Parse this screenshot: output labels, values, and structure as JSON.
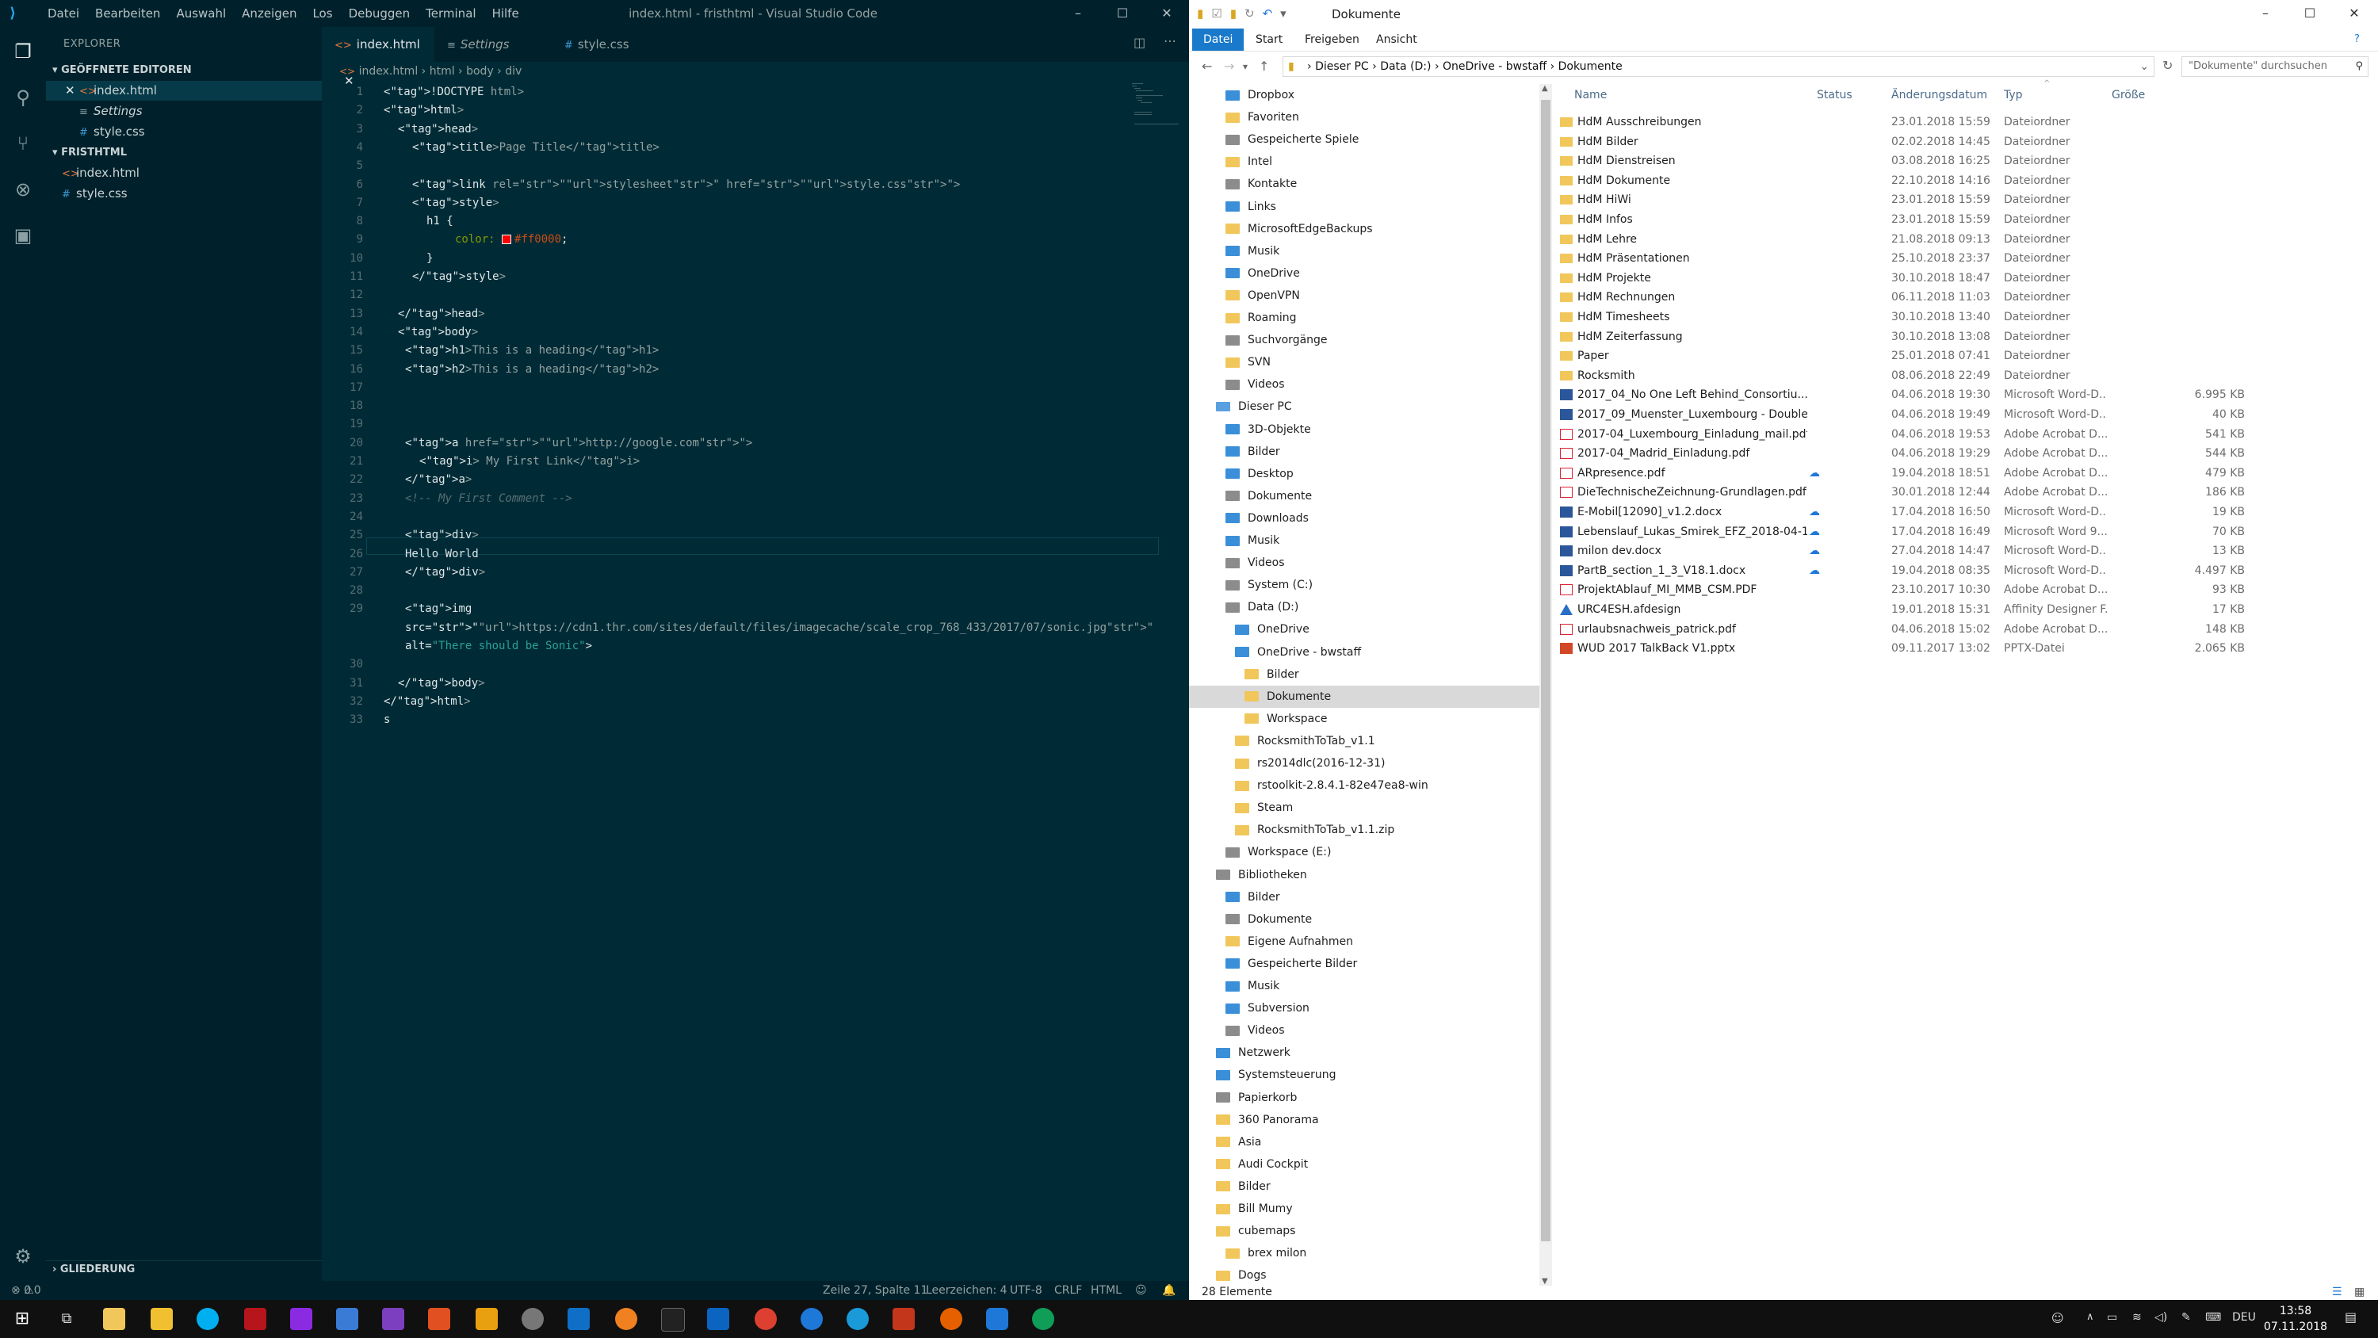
{
  "vscode": {
    "window_title": "index.html - fristhtml - Visual Studio Code",
    "menu": [
      "Datei",
      "Bearbeiten",
      "Auswahl",
      "Anzeigen",
      "Los",
      "Debuggen",
      "Terminal",
      "Hilfe"
    ],
    "sidebar": {
      "title": "EXPLORER",
      "open_editors_title": "GEÖFFNETE EDITOREN",
      "open_editors": [
        "index.html",
        "Settings",
        "style.css"
      ],
      "project_title": "FRISTHTML",
      "project_files": [
        "index.html",
        "style.css"
      ],
      "outline_title": "GLIEDERUNG"
    },
    "tabs": [
      "index.html",
      "Settings",
      "style.css"
    ],
    "breadcrumb": [
      "index.html",
      "html",
      "body",
      "div"
    ],
    "status": {
      "problems": "0",
      "warnings": "0",
      "position": "Zeile 27, Spalte 11",
      "spaces": "Leerzeichen: 4",
      "encoding": "UTF-8",
      "eol": "CRLF",
      "language": "HTML"
    }
  },
  "code_lines": [
    {
      "n": "1",
      "t": "<!DOCTYPE html>"
    },
    {
      "n": "2",
      "t": "<html>"
    },
    {
      "n": "3",
      "t": "<head>"
    },
    {
      "n": "4",
      "t": "<title>Page Title</title>"
    },
    {
      "n": "5",
      "t": ""
    },
    {
      "n": "6",
      "t": "<link rel=\"stylesheet\" href=\"style.css\">"
    },
    {
      "n": "7",
      "t": "<style>"
    },
    {
      "n": "8",
      "t": "h1 {"
    },
    {
      "n": "9",
      "t": "color: #ff0000;"
    },
    {
      "n": "10",
      "t": "}"
    },
    {
      "n": "11",
      "t": "</style>"
    },
    {
      "n": "12",
      "t": ""
    },
    {
      "n": "13",
      "t": "</head>"
    },
    {
      "n": "14",
      "t": "<body>"
    },
    {
      "n": "15",
      "t": "<h1>This is a heading</h1>"
    },
    {
      "n": "16",
      "t": "<h2>This is a heading</h2>"
    },
    {
      "n": "17",
      "t": ""
    },
    {
      "n": "18",
      "t": ""
    },
    {
      "n": "19",
      "t": ""
    },
    {
      "n": "20",
      "t": "<a href=\"http://google.com\">"
    },
    {
      "n": "21",
      "t": "<i> My First Link</i>"
    },
    {
      "n": "22",
      "t": "</a>"
    },
    {
      "n": "23",
      "t": "<!-- My First Comment -->"
    },
    {
      "n": "24",
      "t": ""
    },
    {
      "n": "25",
      "t": "<div>"
    },
    {
      "n": "26",
      "t": "Hello World"
    },
    {
      "n": "27",
      "t": "</div>"
    },
    {
      "n": "28",
      "t": ""
    },
    {
      "n": "29",
      "t": "<img"
    },
    {
      "n": "",
      "t": "src=\"https://cdn1.thr.com/sites/default/files/imagecache/scale_crop_768_433/2017/07/sonic.jpg\""
    },
    {
      "n": "",
      "t": "alt=\"There should be Sonic\">"
    },
    {
      "n": "30",
      "t": ""
    },
    {
      "n": "31",
      "t": "</body>"
    },
    {
      "n": "32",
      "t": "</html>"
    },
    {
      "n": "33",
      "t": "s"
    }
  ],
  "explorer": {
    "window_title": "Dokumente",
    "ribbon_tabs": [
      "Datei",
      "Start",
      "Freigeben",
      "Ansicht"
    ],
    "address": [
      "Dieser PC",
      "Data (D:)",
      "OneDrive - bwstaff",
      "Dokumente"
    ],
    "search_placeholder": "\"Dokumente\" durchsuchen",
    "columns": [
      "Name",
      "Status",
      "Änderungsdatum",
      "Typ",
      "Größe"
    ],
    "nav_items": [
      {
        "label": "Dropbox",
        "icon": "dropbox"
      },
      {
        "label": "Favoriten",
        "icon": "star"
      },
      {
        "label": "Gespeicherte Spiele",
        "icon": "game"
      },
      {
        "label": "Intel",
        "icon": "folder"
      },
      {
        "label": "Kontakte",
        "icon": "contacts"
      },
      {
        "label": "Links",
        "icon": "link"
      },
      {
        "label": "MicrosoftEdgeBackups",
        "icon": "folder"
      },
      {
        "label": "Musik",
        "icon": "music"
      },
      {
        "label": "OneDrive",
        "icon": "cloud"
      },
      {
        "label": "OpenVPN",
        "icon": "folder"
      },
      {
        "label": "Roaming",
        "icon": "folder"
      },
      {
        "label": "Suchvorgänge",
        "icon": "search"
      },
      {
        "label": "SVN",
        "icon": "folder"
      },
      {
        "label": "Videos",
        "icon": "video"
      },
      {
        "label": "Dieser PC",
        "icon": "pc"
      },
      {
        "label": "3D-Objekte",
        "icon": "3d"
      },
      {
        "label": "Bilder",
        "icon": "pictures"
      },
      {
        "label": "Desktop",
        "icon": "desktop"
      },
      {
        "label": "Dokumente",
        "icon": "documents"
      },
      {
        "label": "Downloads",
        "icon": "download"
      },
      {
        "label": "Musik",
        "icon": "music"
      },
      {
        "label": "Videos",
        "icon": "video"
      },
      {
        "label": "System (C:)",
        "icon": "drive"
      },
      {
        "label": "Data (D:)",
        "icon": "drive"
      },
      {
        "label": "OneDrive",
        "icon": "cloud"
      },
      {
        "label": "OneDrive - bwstaff",
        "icon": "cloud"
      },
      {
        "label": "Bilder",
        "icon": "folder"
      },
      {
        "label": "Dokumente",
        "icon": "folder"
      },
      {
        "label": "Workspace",
        "icon": "folder"
      },
      {
        "label": "RocksmithToTab_v1.1",
        "icon": "folder"
      },
      {
        "label": "rs2014dlc(2016-12-31)",
        "icon": "folder"
      },
      {
        "label": "rstoolkit-2.8.4.1-82e47ea8-win",
        "icon": "folder"
      },
      {
        "label": "Steam",
        "icon": "folder"
      },
      {
        "label": "RocksmithToTab_v1.1.zip",
        "icon": "zip"
      },
      {
        "label": "Workspace (E:)",
        "icon": "drive"
      },
      {
        "label": "Bibliotheken",
        "icon": "library"
      },
      {
        "label": "Bilder",
        "icon": "pictures"
      },
      {
        "label": "Dokumente",
        "icon": "documents"
      },
      {
        "label": "Eigene Aufnahmen",
        "icon": "folder"
      },
      {
        "label": "Gespeicherte Bilder",
        "icon": "pictures"
      },
      {
        "label": "Musik",
        "icon": "music"
      },
      {
        "label": "Subversion",
        "icon": "svn"
      },
      {
        "label": "Videos",
        "icon": "video"
      },
      {
        "label": "Netzwerk",
        "icon": "network"
      },
      {
        "label": "Systemsteuerung",
        "icon": "control"
      },
      {
        "label": "Papierkorb",
        "icon": "trash"
      },
      {
        "label": "360 Panorama",
        "icon": "folder"
      },
      {
        "label": "Asia",
        "icon": "folder"
      },
      {
        "label": "Audi Cockpit",
        "icon": "folder"
      },
      {
        "label": "Bilder",
        "icon": "folder"
      },
      {
        "label": "Bill Mumy",
        "icon": "folder"
      },
      {
        "label": "cubemaps",
        "icon": "folder"
      },
      {
        "label": "brex milon",
        "icon": "folder"
      },
      {
        "label": "Dogs",
        "icon": "folder"
      }
    ],
    "files": [
      {
        "name": "HdM Ausschreibungen",
        "status": "",
        "date": "23.01.2018 15:59",
        "type": "Dateiordner",
        "size": "",
        "icon": "folder"
      },
      {
        "name": "HdM Bilder",
        "status": "",
        "date": "02.02.2018 14:45",
        "type": "Dateiordner",
        "size": "",
        "icon": "folder"
      },
      {
        "name": "HdM Dienstreisen",
        "status": "",
        "date": "03.08.2018 16:25",
        "type": "Dateiordner",
        "size": "",
        "icon": "folder"
      },
      {
        "name": "HdM Dokumente",
        "status": "",
        "date": "22.10.2018 14:16",
        "type": "Dateiordner",
        "size": "",
        "icon": "folder"
      },
      {
        "name": "HdM HiWi",
        "status": "",
        "date": "23.01.2018 15:59",
        "type": "Dateiordner",
        "size": "",
        "icon": "folder"
      },
      {
        "name": "HdM Infos",
        "status": "",
        "date": "23.01.2018 15:59",
        "type": "Dateiordner",
        "size": "",
        "icon": "folder"
      },
      {
        "name": "HdM Lehre",
        "status": "",
        "date": "21.08.2018 09:13",
        "type": "Dateiordner",
        "size": "",
        "icon": "folder"
      },
      {
        "name": "HdM Präsentationen",
        "status": "",
        "date": "25.10.2018 23:37",
        "type": "Dateiordner",
        "size": "",
        "icon": "folder"
      },
      {
        "name": "HdM Projekte",
        "status": "",
        "date": "30.10.2018 18:47",
        "type": "Dateiordner",
        "size": "",
        "icon": "folder"
      },
      {
        "name": "HdM Rechnungen",
        "status": "",
        "date": "06.11.2018 11:03",
        "type": "Dateiordner",
        "size": "",
        "icon": "folder"
      },
      {
        "name": "HdM Timesheets",
        "status": "",
        "date": "30.10.2018 13:40",
        "type": "Dateiordner",
        "size": "",
        "icon": "folder"
      },
      {
        "name": "HdM Zeiterfassung",
        "status": "",
        "date": "30.10.2018 13:08",
        "type": "Dateiordner",
        "size": "",
        "icon": "folder"
      },
      {
        "name": "Paper",
        "status": "",
        "date": "25.01.2018 07:41",
        "type": "Dateiordner",
        "size": "",
        "icon": "folder"
      },
      {
        "name": "Rocksmith",
        "status": "",
        "date": "08.06.2018 22:49",
        "type": "Dateiordner",
        "size": "",
        "icon": "folder"
      },
      {
        "name": "2017_04_No One Left Behind_Consortiu...",
        "status": "",
        "date": "04.06.2018 19:30",
        "type": "Microsoft Word-D...",
        "size": "6.995 KB",
        "icon": "word"
      },
      {
        "name": "2017_09_Muenster_Luxembourg - Double...",
        "status": "",
        "date": "04.06.2018 19:49",
        "type": "Microsoft Word-D...",
        "size": "40 KB",
        "icon": "word"
      },
      {
        "name": "2017-04_Luxembourg_Einladung_mail.pdf",
        "status": "",
        "date": "04.06.2018 19:53",
        "type": "Adobe Acrobat D...",
        "size": "541 KB",
        "icon": "pdf"
      },
      {
        "name": "2017-04_Madrid_Einladung.pdf",
        "status": "",
        "date": "04.06.2018 19:29",
        "type": "Adobe Acrobat D...",
        "size": "544 KB",
        "icon": "pdf"
      },
      {
        "name": "ARpresence.pdf",
        "status": "☁",
        "date": "19.04.2018 18:51",
        "type": "Adobe Acrobat D...",
        "size": "479 KB",
        "icon": "pdf"
      },
      {
        "name": "DieTechnischeZeichnung-Grundlagen.pdf",
        "status": "",
        "date": "30.01.2018 12:44",
        "type": "Adobe Acrobat D...",
        "size": "186 KB",
        "icon": "pdf"
      },
      {
        "name": "E-Mobil[12090]_v1.2.docx",
        "status": "☁",
        "date": "17.04.2018 16:50",
        "type": "Microsoft Word-D...",
        "size": "19 KB",
        "icon": "word"
      },
      {
        "name": "Lebenslauf_Lukas_Smirek_EFZ_2018-04-1...",
        "status": "☁",
        "date": "17.04.2018 16:49",
        "type": "Microsoft Word 9...",
        "size": "70 KB",
        "icon": "word"
      },
      {
        "name": "milon dev.docx",
        "status": "☁",
        "date": "27.04.2018 14:47",
        "type": "Microsoft Word-D...",
        "size": "13 KB",
        "icon": "word"
      },
      {
        "name": "PartB_section_1_3_V18.1.docx",
        "status": "☁",
        "date": "19.04.2018 08:35",
        "type": "Microsoft Word-D...",
        "size": "4.497 KB",
        "icon": "word"
      },
      {
        "name": "ProjektAblauf_MI_MMB_CSM.PDF",
        "status": "",
        "date": "23.10.2017 10:30",
        "type": "Adobe Acrobat D...",
        "size": "93 KB",
        "icon": "pdf"
      },
      {
        "name": "URC4ESH.afdesign",
        "status": "",
        "date": "19.01.2018 15:31",
        "type": "Affinity Designer F...",
        "size": "17 KB",
        "icon": "aff"
      },
      {
        "name": "urlaubsnachweis_patrick.pdf",
        "status": "",
        "date": "04.06.2018 15:02",
        "type": "Adobe Acrobat D...",
        "size": "148 KB",
        "icon": "pdf"
      },
      {
        "name": "WUD 2017 TalkBack V1.pptx",
        "status": "",
        "date": "09.11.2017 13:02",
        "type": "PPTX-Datei",
        "size": "2.065 KB",
        "icon": "ppt"
      }
    ],
    "status": "28 Elemente"
  },
  "taskbar": {
    "time": "13:58",
    "date": "07.11.2018",
    "lang": "DEU"
  }
}
